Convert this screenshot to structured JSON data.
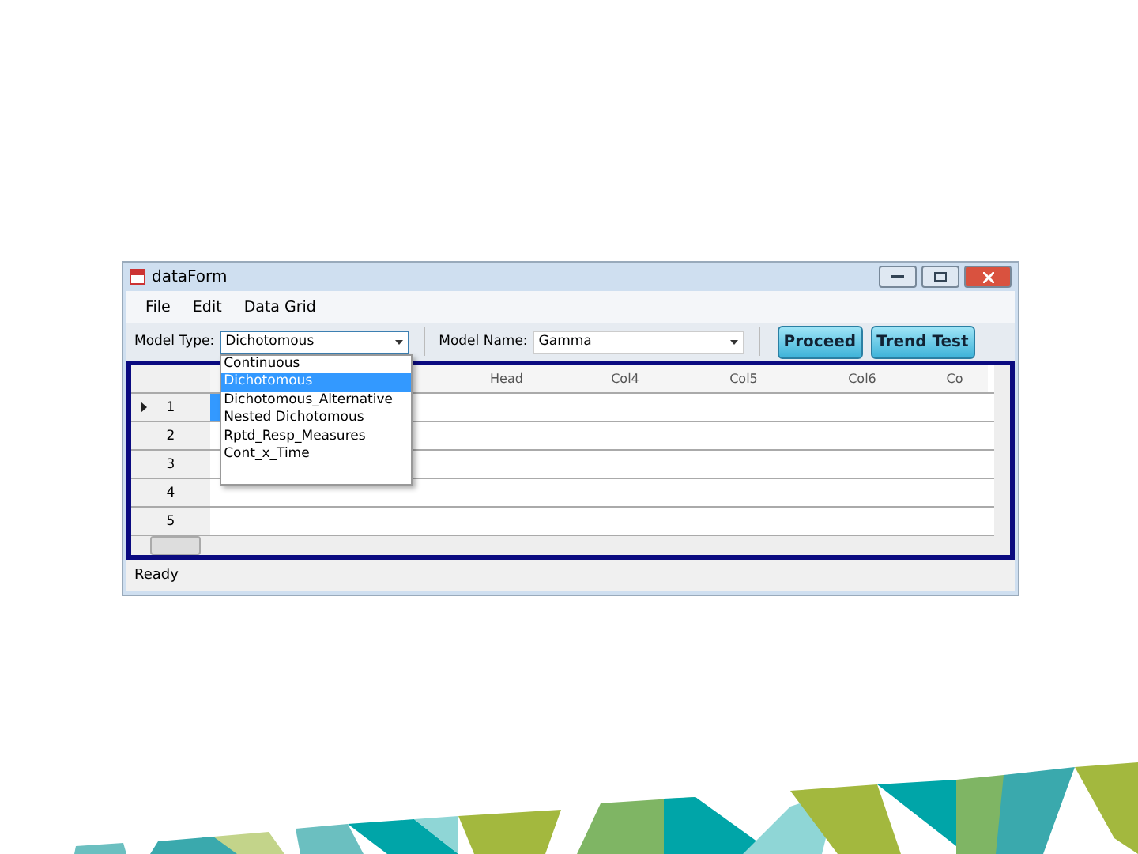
{
  "window": {
    "title": "dataForm"
  },
  "menu": [
    "File",
    "Edit",
    "Data Grid"
  ],
  "toolbar": {
    "model_type_label": "Model Type:",
    "model_type_value": "Dichotomous",
    "model_name_label": "Model Name:",
    "model_name_value": "Gamma",
    "buttons": [
      "Proceed",
      "Trend Test"
    ]
  },
  "dropdown": {
    "expanded": true,
    "options": [
      {
        "label": "Continuous",
        "selected": false
      },
      {
        "label": "Dichotomous",
        "selected": true
      },
      {
        "label": "Dichotomous_Alternative",
        "selected": false
      },
      {
        "label": "Nested Dichotomous",
        "selected": false
      },
      {
        "label": "Rptd_Resp_Measures",
        "selected": false
      },
      {
        "label": "Cont_x_Time",
        "selected": false
      }
    ]
  },
  "grid": {
    "columns": [
      "Head",
      "Col4",
      "Col5",
      "Col6",
      "Co"
    ],
    "rows": [
      {
        "label": "1",
        "selected": true
      },
      {
        "label": "2",
        "selected": false
      },
      {
        "label": "3",
        "selected": false
      },
      {
        "label": "4",
        "selected": false
      },
      {
        "label": "5",
        "selected": false
      }
    ]
  },
  "status_bar": "Ready"
}
